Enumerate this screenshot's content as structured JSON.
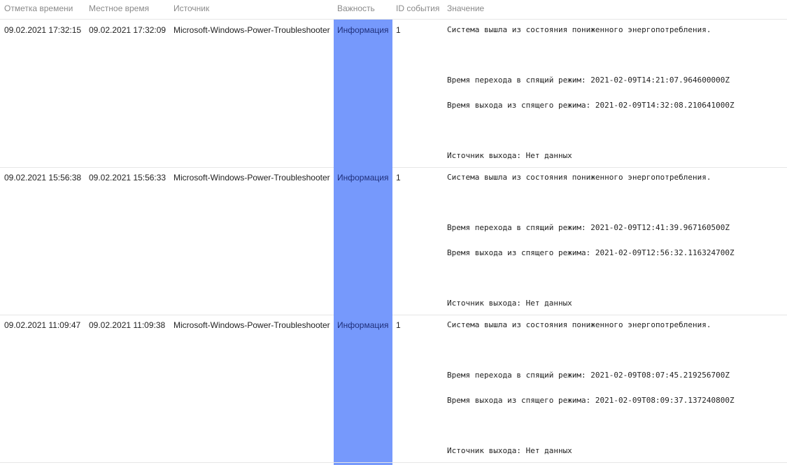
{
  "columns": {
    "timestamp": "Отметка времени",
    "local_time": "Местное время",
    "source": "Источник",
    "severity": "Важность",
    "event_id": "ID события",
    "value": "Значение"
  },
  "rows": [
    {
      "timestamp": "09.02.2021 17:32:15",
      "local_time": "09.02.2021 17:32:09",
      "source": "Microsoft-Windows-Power-Troubleshooter",
      "severity": "Информация",
      "event_id": "1",
      "message": {
        "line1": "Система вышла из состояния пониженного энергопотребления.",
        "line2": "Время перехода в спящий режим: 2021-02-09T14:21:07.964600000Z",
        "line3": "Время выхода из спящего режима: 2021-02-09T14:32:08.210641000Z",
        "line4": "Источник выхода: Нет данных"
      }
    },
    {
      "timestamp": "09.02.2021 15:56:38",
      "local_time": "09.02.2021 15:56:33",
      "source": "Microsoft-Windows-Power-Troubleshooter",
      "severity": "Информация",
      "event_id": "1",
      "message": {
        "line1": "Система вышла из состояния пониженного энергопотребления.",
        "line2": "Время перехода в спящий режим: 2021-02-09T12:41:39.967160500Z",
        "line3": "Время выхода из спящего режима: 2021-02-09T12:56:32.116324700Z",
        "line4": "Источник выхода: Нет данных"
      }
    },
    {
      "timestamp": "09.02.2021 11:09:47",
      "local_time": "09.02.2021 11:09:38",
      "source": "Microsoft-Windows-Power-Troubleshooter",
      "severity": "Информация",
      "event_id": "1",
      "message": {
        "line1": "Система вышла из состояния пониженного энергопотребления.",
        "line2": "Время перехода в спящий режим: 2021-02-09T08:07:45.219256700Z",
        "line3": "Время выхода из спящего режима: 2021-02-09T08:09:37.137240800Z",
        "line4": "Источник выхода: Нет данных"
      }
    }
  ],
  "colors": {
    "severity_info_bg": "#7699fc",
    "header_text": "#8a8a8a",
    "row_divider": "#e6e6e6"
  }
}
